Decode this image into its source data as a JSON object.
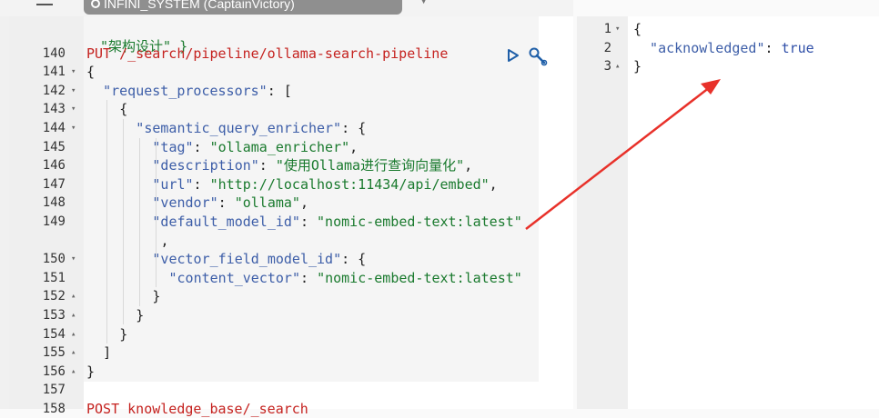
{
  "tab": {
    "title": "INFINI_SYSTEM (CaptainVictory)"
  },
  "editor": {
    "partial_top_line": "\"架构设计\" }",
    "lines": [
      {
        "num": "140",
        "fold": "",
        "indent": 0,
        "segments": [
          {
            "t": "PUT ",
            "c": "k"
          },
          {
            "t": "/_search/pipeline/ollama-search-pipeline",
            "c": "k"
          }
        ]
      },
      {
        "num": "141",
        "fold": "▾",
        "indent": 0,
        "segments": [
          {
            "t": "{",
            "c": "b"
          }
        ]
      },
      {
        "num": "142",
        "fold": "▾",
        "indent": 2,
        "segments": [
          {
            "t": "\"request_processors\"",
            "c": "p"
          },
          {
            "t": ": [",
            "c": "b"
          }
        ]
      },
      {
        "num": "143",
        "fold": "▾",
        "indent": 4,
        "segments": [
          {
            "t": "{",
            "c": "b"
          }
        ]
      },
      {
        "num": "144",
        "fold": "▾",
        "indent": 6,
        "segments": [
          {
            "t": "\"semantic_query_enricher\"",
            "c": "p"
          },
          {
            "t": ": {",
            "c": "b"
          }
        ]
      },
      {
        "num": "145",
        "fold": "",
        "indent": 8,
        "segments": [
          {
            "t": "\"tag\"",
            "c": "p"
          },
          {
            "t": ": ",
            "c": "b"
          },
          {
            "t": "\"ollama_enricher\"",
            "c": "s"
          },
          {
            "t": ",",
            "c": "b"
          }
        ]
      },
      {
        "num": "146",
        "fold": "",
        "indent": 8,
        "segments": [
          {
            "t": "\"description\"",
            "c": "p"
          },
          {
            "t": ": ",
            "c": "b"
          },
          {
            "t": "\"使用Ollama进行查询向量化\"",
            "c": "s"
          },
          {
            "t": ",",
            "c": "b"
          }
        ]
      },
      {
        "num": "147",
        "fold": "",
        "indent": 8,
        "segments": [
          {
            "t": "\"url\"",
            "c": "p"
          },
          {
            "t": ": ",
            "c": "b"
          },
          {
            "t": "\"http://localhost:11434/api/embed\"",
            "c": "s"
          },
          {
            "t": ",",
            "c": "b"
          }
        ]
      },
      {
        "num": "148",
        "fold": "",
        "indent": 8,
        "segments": [
          {
            "t": "\"vendor\"",
            "c": "p"
          },
          {
            "t": ": ",
            "c": "b"
          },
          {
            "t": "\"ollama\"",
            "c": "s"
          },
          {
            "t": ",",
            "c": "b"
          }
        ]
      },
      {
        "num": "149",
        "fold": "",
        "indent": 8,
        "segments": [
          {
            "t": "\"default_model_id\"",
            "c": "p"
          },
          {
            "t": ": ",
            "c": "b"
          },
          {
            "t": "\"nomic-embed-text:latest\"",
            "c": "s"
          }
        ]
      },
      {
        "num": "",
        "fold": "",
        "indent": 9,
        "segments": [
          {
            "t": ",",
            "c": "b"
          }
        ]
      },
      {
        "num": "150",
        "fold": "▾",
        "indent": 8,
        "segments": [
          {
            "t": "\"vector_field_model_id\"",
            "c": "p"
          },
          {
            "t": ": {",
            "c": "b"
          }
        ]
      },
      {
        "num": "151",
        "fold": "",
        "indent": 10,
        "segments": [
          {
            "t": "\"content_vector\"",
            "c": "p"
          },
          {
            "t": ": ",
            "c": "b"
          },
          {
            "t": "\"nomic-embed-text:latest\"",
            "c": "s"
          }
        ]
      },
      {
        "num": "152",
        "fold": "▴",
        "indent": 8,
        "segments": [
          {
            "t": "}",
            "c": "b"
          }
        ]
      },
      {
        "num": "153",
        "fold": "▴",
        "indent": 6,
        "segments": [
          {
            "t": "}",
            "c": "b"
          }
        ]
      },
      {
        "num": "154",
        "fold": "▴",
        "indent": 4,
        "segments": [
          {
            "t": "}",
            "c": "b"
          }
        ]
      },
      {
        "num": "155",
        "fold": "▴",
        "indent": 2,
        "segments": [
          {
            "t": "]",
            "c": "b"
          }
        ]
      },
      {
        "num": "156",
        "fold": "▴",
        "indent": 0,
        "segments": [
          {
            "t": "}",
            "c": "b"
          }
        ]
      },
      {
        "num": "157",
        "fold": "",
        "indent": 0,
        "segments": []
      },
      {
        "num": "158",
        "fold": "",
        "indent": 0,
        "segments": [
          {
            "t": "POST ",
            "c": "k"
          },
          {
            "t": "knowledge_base/_search",
            "c": "k"
          }
        ]
      }
    ]
  },
  "response": {
    "lines": [
      {
        "num": "1",
        "fold": "▾",
        "segments": [
          {
            "t": "{",
            "c": "b"
          }
        ]
      },
      {
        "num": "2",
        "fold": "",
        "segments": [
          {
            "t": "  \"acknowledged\"",
            "c": "p"
          },
          {
            "t": ": ",
            "c": "b"
          },
          {
            "t": "true",
            "c": "bool"
          }
        ]
      },
      {
        "num": "3",
        "fold": "▴",
        "segments": [
          {
            "t": "}",
            "c": "b"
          }
        ]
      }
    ]
  },
  "colors": {
    "method": "#c5221f",
    "property": "#3d5ea8",
    "string": "#1a7a2e",
    "boolean": "#2f4fa8",
    "arrow": "#e8312a"
  },
  "icons": {
    "run": "play-icon",
    "settings": "wrench-icon"
  }
}
